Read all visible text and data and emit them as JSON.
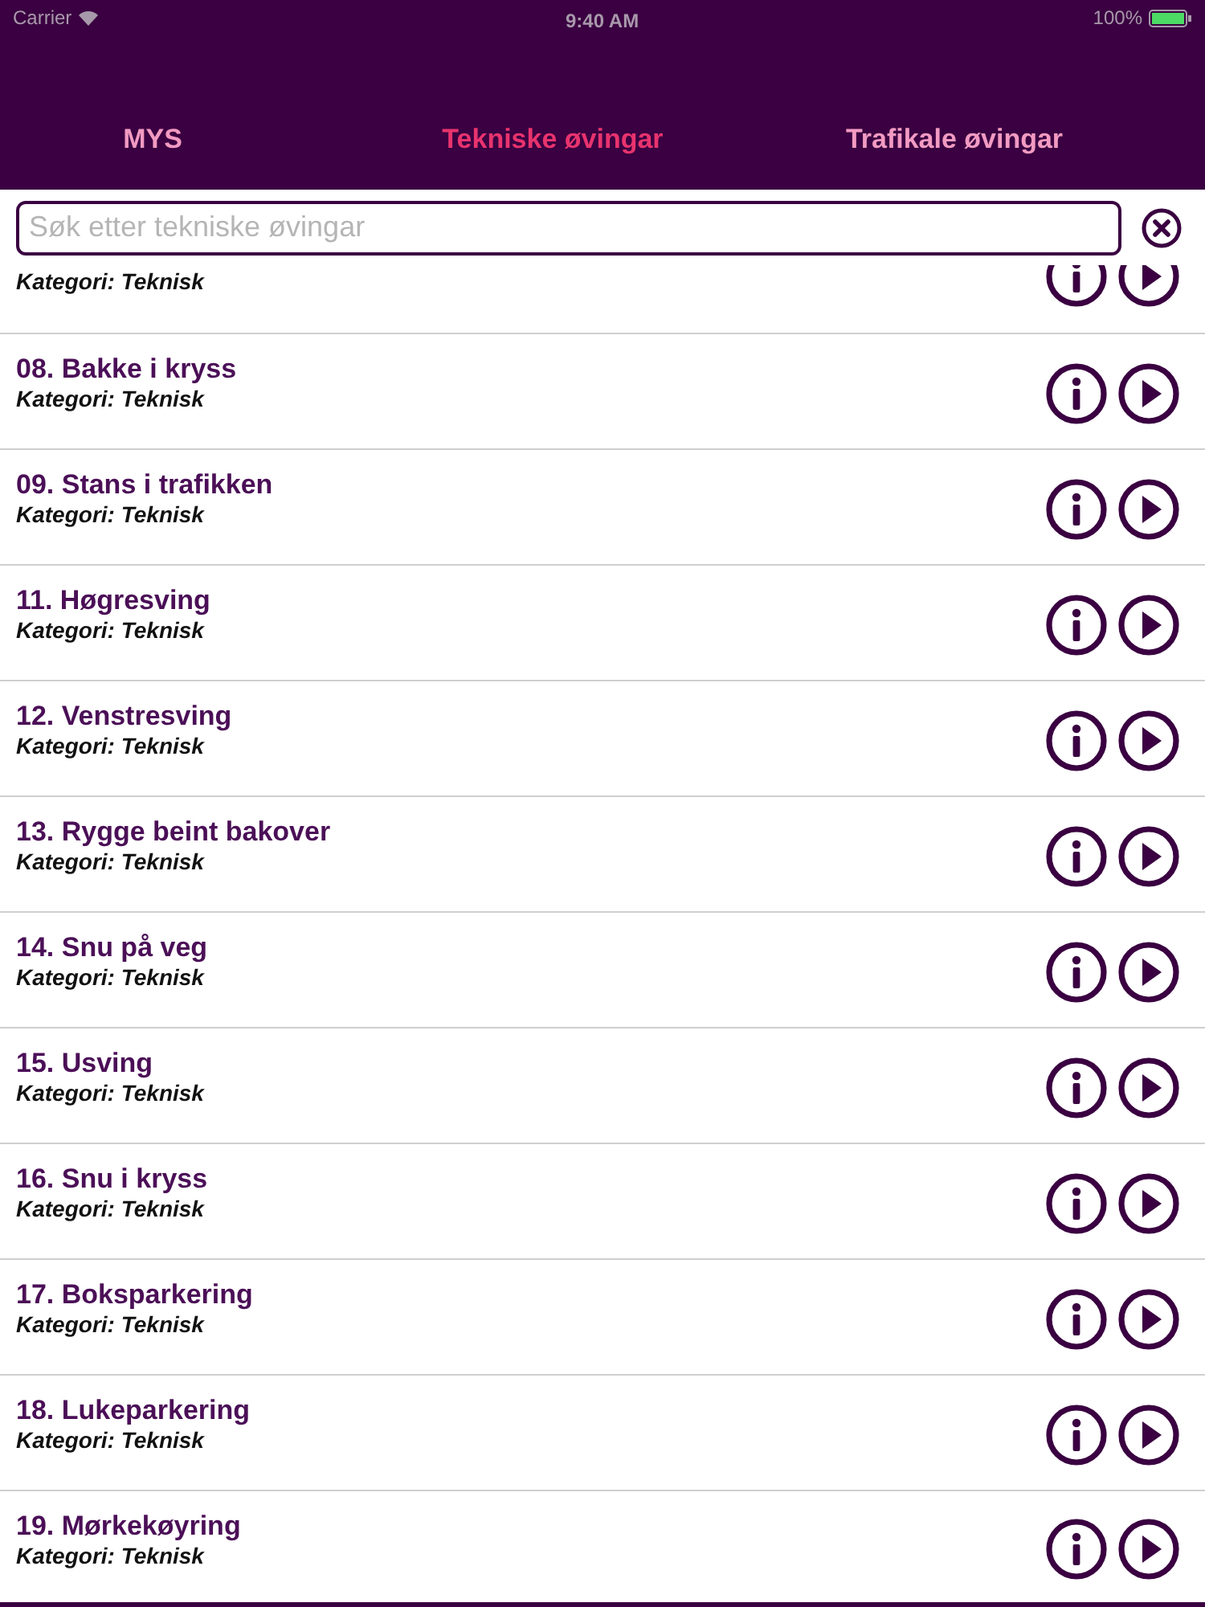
{
  "status_bar": {
    "carrier": "Carrier",
    "time": "9:40 AM",
    "battery": "100%"
  },
  "tabs": [
    {
      "label": "MYS",
      "selected": false
    },
    {
      "label": "Tekniske øvingar",
      "selected": true
    },
    {
      "label": "Trafikale øvingar",
      "selected": false
    }
  ],
  "search": {
    "placeholder": "Søk etter tekniske øvingar"
  },
  "exercises": [
    {
      "kind": "partial",
      "category": "Kategori: Teknisk"
    },
    {
      "kind": "full",
      "title": "08. Bakke i kryss",
      "category": "Kategori: Teknisk"
    },
    {
      "kind": "full",
      "title": "09. Stans i trafikken",
      "category": "Kategori: Teknisk"
    },
    {
      "kind": "full",
      "title": "11. Høgresving",
      "category": "Kategori: Teknisk"
    },
    {
      "kind": "full",
      "title": "12. Venstresving",
      "category": "Kategori: Teknisk"
    },
    {
      "kind": "full",
      "title": "13. Rygge beint bakover",
      "category": "Kategori: Teknisk"
    },
    {
      "kind": "full",
      "title": "14. Snu på veg",
      "category": "Kategori: Teknisk"
    },
    {
      "kind": "full",
      "title": "15. Usving",
      "category": "Kategori: Teknisk"
    },
    {
      "kind": "full",
      "title": "16. Snu i kryss",
      "category": "Kategori: Teknisk"
    },
    {
      "kind": "full",
      "title": "17. Boksparkering",
      "category": "Kategori: Teknisk"
    },
    {
      "kind": "full",
      "title": "18. Lukeparkering",
      "category": "Kategori: Teknisk"
    },
    {
      "kind": "full",
      "title": "19. Mørkekøyring",
      "category": "Kategori: Teknisk"
    }
  ]
}
